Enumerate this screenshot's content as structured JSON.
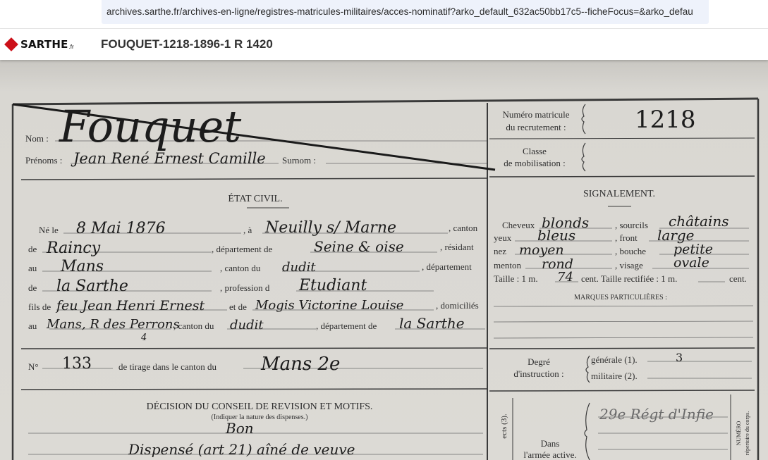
{
  "browser": {
    "url": "archives.sarthe.fr/archives-en-ligne/registres-matricules-militaires/acces-nominatif?arko_default_632ac50bb17c5--ficheFocus=&arko_defau"
  },
  "site": {
    "logo_text": "SARTHE",
    "logo_suffix": ".fr",
    "document_title": "FOUQUET-1218-1896-1 R 1420",
    "brand_color": "#cc1019"
  },
  "form": {
    "nom_label": "Nom :",
    "prenoms_label": "Prénoms :",
    "surnom_label": "Surnom :",
    "numero_matricule_label_1": "Numéro matricule",
    "numero_matricule_label_2": "du recrutement :",
    "classe_label_1": "Classe",
    "classe_label_2": "de mobilisation :",
    "etat_civil_title": "ÉTAT CIVIL.",
    "ne_le_label": "Né le",
    "a_label": ", à",
    "canton_label": ", canton",
    "de_label_1": "de",
    "departement_de_label": ", département de",
    "residant_label": ", résidant",
    "au_label_1": "au",
    "canton_du_label": ", canton du",
    "departement_label": ", département",
    "de_label_2": "de",
    "profession_label": ", profession d",
    "fils_de_label": "fils de",
    "et_de_label": "et de",
    "domicilies_label": ", domiciliés",
    "au_label_2": "au",
    "canton_du_label_2": ", canton du",
    "departement_de_label_2": ", département de",
    "no_label": "N°",
    "tirage_label": "de tirage dans le canton du",
    "decision_title": "DÉCISION DU CONSEIL DE REVISION ET MOTIFS.",
    "decision_subtitle": "(Indiquer la nature des dispenses.)",
    "signalement_title": "SIGNALEMENT.",
    "cheveux_label": "Cheveux",
    "sourcils_label": ", sourcils",
    "yeux_label": "yeux",
    "front_label": ", front",
    "nez_label": "nez",
    "bouche_label": ", bouche",
    "menton_label": "menton",
    "visage_label": ", visage",
    "taille_label": "Taille : 1 m.",
    "taille_cent_label": "cent. Taille rectifiée : 1 m.",
    "taille_cent_label_2": "cent.",
    "marques_label": "MARQUES PARTICULIÈRES :",
    "degre_label_1": "Degré",
    "degre_label_2": "d'instruction :",
    "generale_label": "générale (1).",
    "militaire_label": "militaire (2).",
    "dans_label_1": "Dans",
    "dans_label_2": "l'armée active.",
    "side_label_1": "ects (3).",
    "side_label_2": "NUMÉRO",
    "side_label_3": "répertoire du corps."
  },
  "handwriting": {
    "nom": "Fouquet",
    "prenoms": "Jean René Ernest Camille",
    "matricule": "1218",
    "naissance_date": "8 Mai 1876",
    "naissance_lieu": "Neuilly s/ Marne",
    "canton": "Raincy",
    "departement": "Seine & oise",
    "residence": "Mans",
    "residence_canton": "dudit",
    "residence_departement": "la Sarthe",
    "profession": "Etudiant",
    "pere": "feu Jean Henri Ernest",
    "mere": "Mogis Victorine Louise",
    "domicile": "Mans, R des Perrons",
    "domicile_numero": "4",
    "domicile_canton": "dudit",
    "domicile_departement": "la Sarthe",
    "tirage_numero": "133",
    "tirage_canton": "Mans 2e",
    "decision_1": "Bon",
    "decision_2": "Dispensé (art 21) aîné de veuve",
    "cheveux": "blonds",
    "sourcils": "châtains",
    "yeux": "bleus",
    "front": "large",
    "nez": "moyen",
    "bouche": "petite",
    "menton": "rond",
    "visage": "ovale",
    "taille_cm": "74",
    "instruction_generale": "3",
    "corps": "29e Régt d'Infie"
  }
}
